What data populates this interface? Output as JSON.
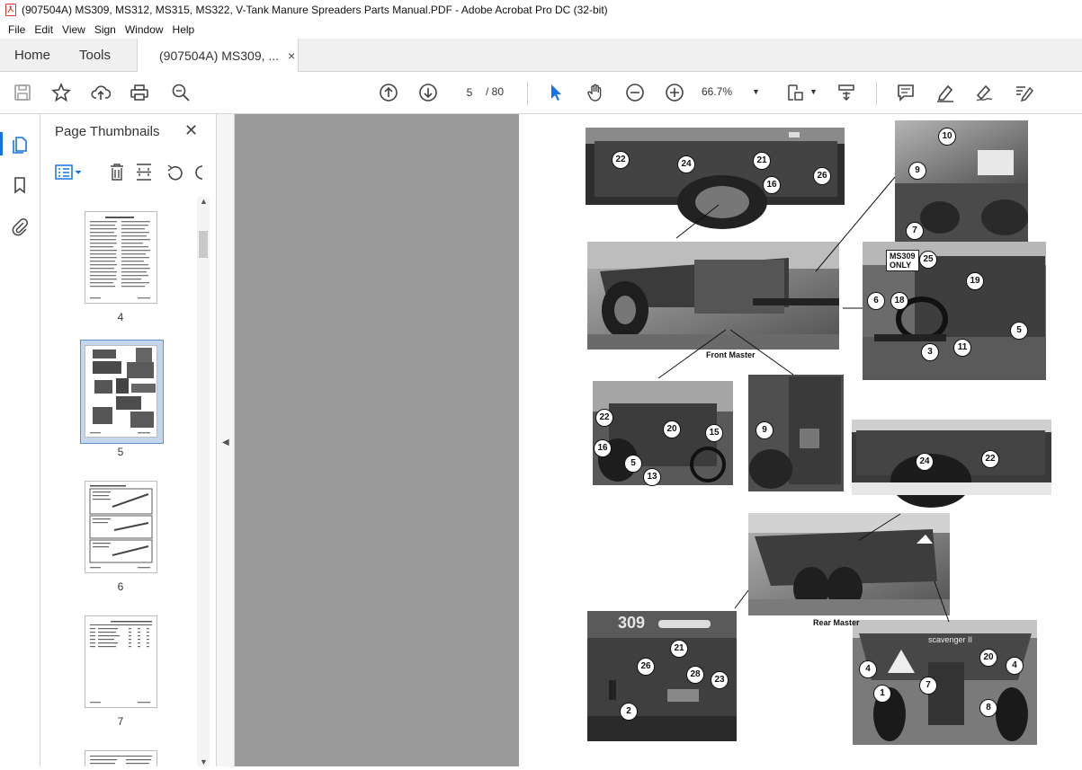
{
  "window": {
    "title": "(907504A) MS309, MS312, MS315, MS322, V-Tank Manure Spreaders Parts Manual.PDF - Adobe Acrobat Pro DC (32-bit)"
  },
  "menu": [
    "File",
    "Edit",
    "View",
    "Sign",
    "Window",
    "Help"
  ],
  "tabs": {
    "home": "Home",
    "tools": "Tools",
    "document": "(907504A) MS309, ...",
    "close": "×"
  },
  "toolbar": {
    "current_page": "5",
    "page_total": "/ 80",
    "zoom": "66.7%"
  },
  "thumbnails": {
    "title": "Page Thumbnails",
    "close": "✕",
    "pages": [
      "4",
      "5",
      "6",
      "7"
    ],
    "selected": "5"
  },
  "document_page": {
    "captions": {
      "front": "Front Master",
      "rear": "Rear Master",
      "ms309_only_line1": "MS309",
      "ms309_only_line2": "ONLY"
    },
    "callouts": [
      "22",
      "24",
      "21",
      "16",
      "26",
      "10",
      "9",
      "7",
      "25",
      "19",
      "6",
      "18",
      "5",
      "3",
      "11",
      "22",
      "20",
      "15",
      "16",
      "5",
      "13",
      "9",
      "24",
      "22",
      "21",
      "26",
      "28",
      "23",
      "2",
      "20",
      "4",
      "4",
      "1",
      "7",
      "8"
    ]
  },
  "colors": {
    "accent": "#1473e6",
    "viewer_bg": "#9a9a9a",
    "pdf_red": "#d9312b"
  }
}
